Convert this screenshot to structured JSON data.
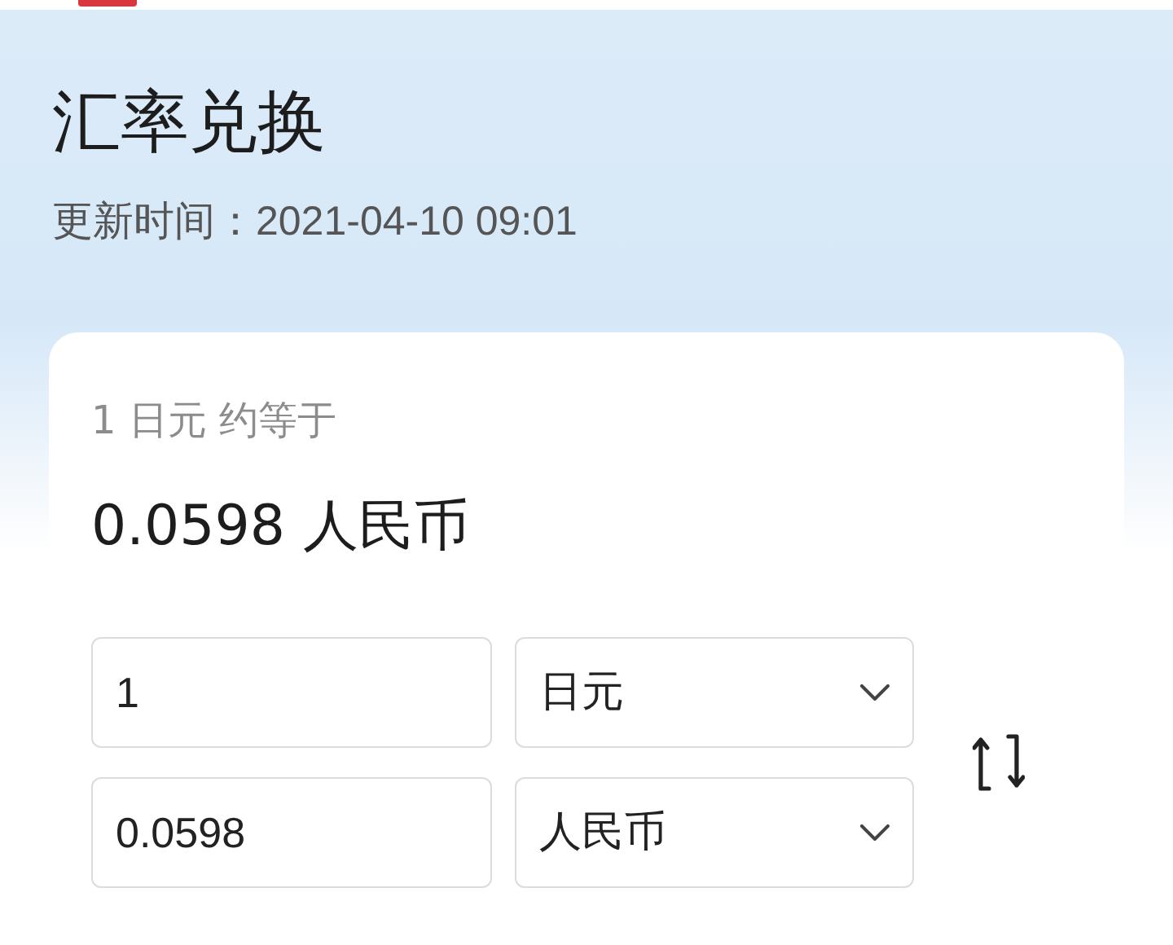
{
  "header": {
    "title": "汇率兑换",
    "update_time": "更新时间：2021-04-10 09:01"
  },
  "converter": {
    "rate_caption": "1 日元 约等于",
    "rate_result": "0.0598 人民币",
    "rows": [
      {
        "amount": "1",
        "currency": "日元"
      },
      {
        "amount": "0.0598",
        "currency": "人民币"
      }
    ]
  }
}
